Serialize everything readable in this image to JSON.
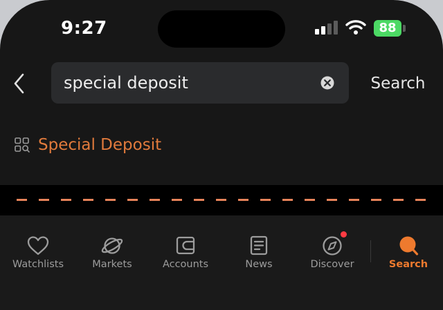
{
  "status_bar": {
    "time": "9:27",
    "battery_percent": "88"
  },
  "search": {
    "query": "special deposit",
    "submit_label": "Search",
    "back_icon": "chevron-left-icon",
    "clear_icon": "clear-circle-icon"
  },
  "suggestions": [
    {
      "label": "Special Deposit",
      "icon": "grid-search-icon"
    }
  ],
  "tabs": [
    {
      "label": "Watchlists",
      "icon": "heart-icon",
      "active": false
    },
    {
      "label": "Markets",
      "icon": "planet-icon",
      "active": false
    },
    {
      "label": "Accounts",
      "icon": "wallet-icon",
      "active": false
    },
    {
      "label": "News",
      "icon": "document-icon",
      "active": false
    },
    {
      "label": "Discover",
      "icon": "compass-icon",
      "active": false,
      "badge_dot": true
    },
    {
      "label": "Search",
      "icon": "search-icon",
      "active": true
    }
  ],
  "colors": {
    "accent": "#ee7a2e",
    "suggestion_text": "#e07a3c",
    "battery": "#4cd964",
    "notification_dot": "#ff3b43",
    "background": "#171717"
  }
}
